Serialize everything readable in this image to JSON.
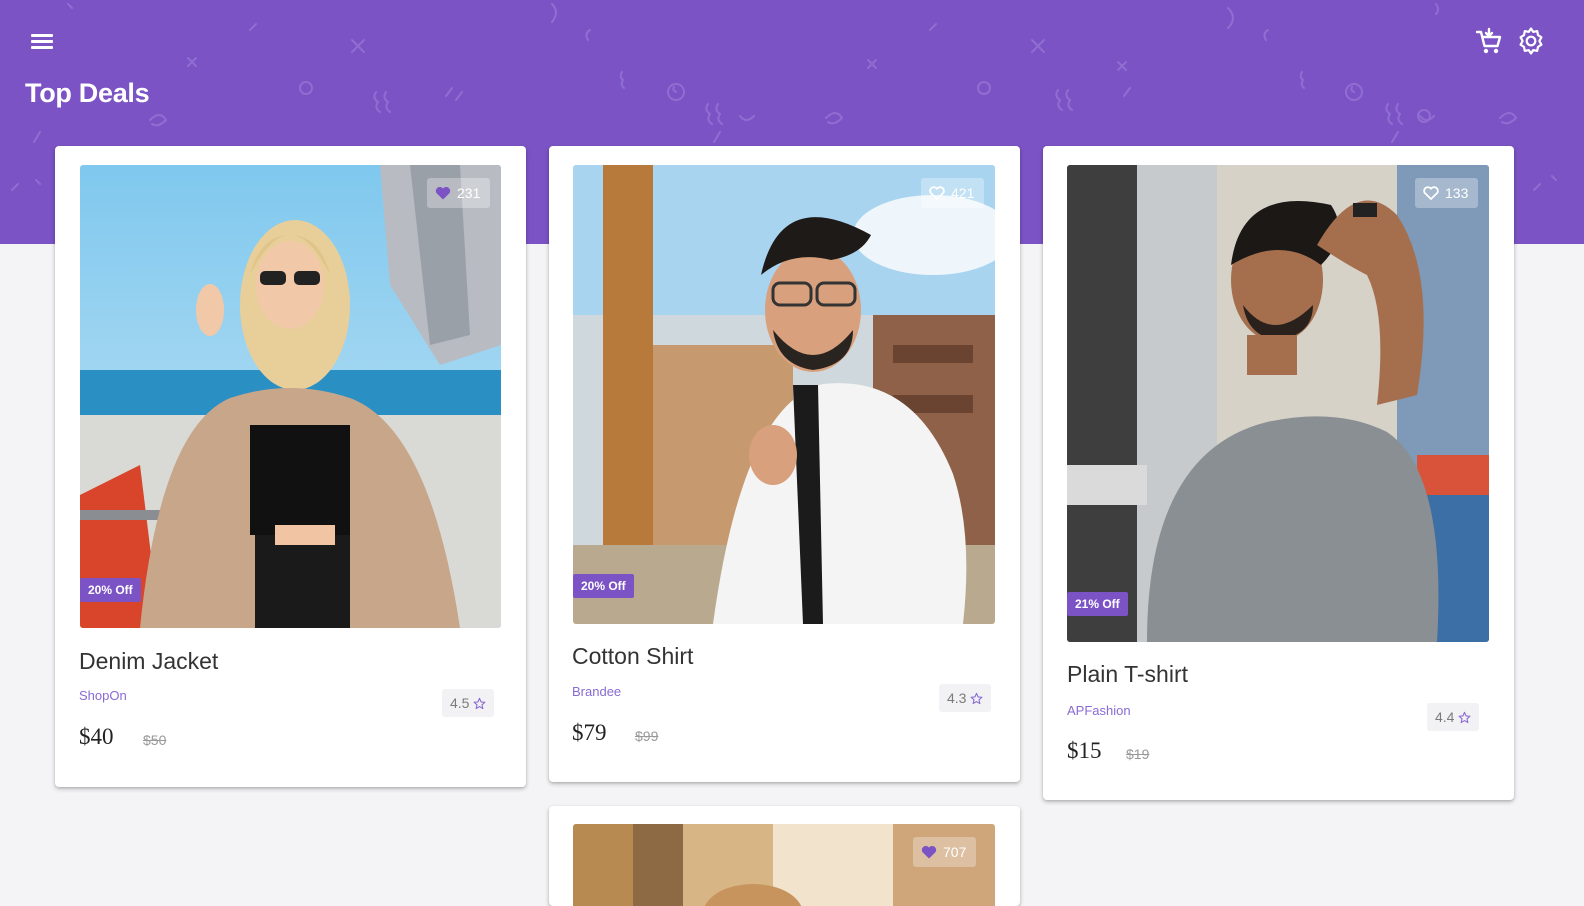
{
  "header": {
    "title": "Top Deals",
    "menu_icon": "hamburger-menu-icon",
    "cart_icon": "shopping-cart-icon",
    "settings_icon": "settings-icon",
    "background_color": "#7b53c5"
  },
  "colors": {
    "accent": "#7b53c5",
    "brand_text": "#8a6ad3",
    "page_background": "#f4f4f6"
  },
  "products": [
    {
      "name": "Denim Jacket",
      "brand": "ShopOn",
      "rating": "4.5",
      "price": "$40",
      "original_price": "$50",
      "discount": "20% Off",
      "likes": "231",
      "liked": true
    },
    {
      "name": "Cotton Shirt",
      "brand": "Brandee",
      "rating": "4.3",
      "price": "$79",
      "original_price": "$99",
      "discount": "20% Off",
      "likes": "421",
      "liked": false
    },
    {
      "name": "Plain T-shirt",
      "brand": "APFashion",
      "rating": "4.4",
      "price": "$15",
      "original_price": "$19",
      "discount": "21% Off",
      "likes": "133",
      "liked": false
    },
    {
      "likes": "707",
      "liked": true
    }
  ]
}
